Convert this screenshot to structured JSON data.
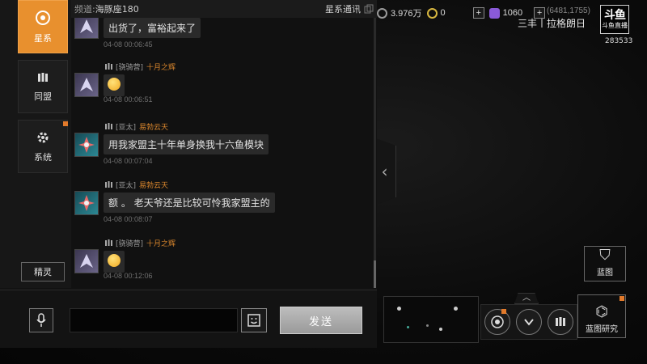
{
  "top_bar": {
    "resources": [
      {
        "icon": "credit-icon",
        "value": "3.976万",
        "color": "#9a9a9a"
      },
      {
        "icon": "alloy-icon",
        "value": "0",
        "color": "#d6b640"
      },
      {
        "icon": "crystal-icon",
        "value": "1060",
        "color": "#8a5ad8"
      }
    ],
    "plus_label": "+",
    "coordinates": "(6481,1755)",
    "player_name": "三丰丨拉格朗日",
    "logo_text": "斗鱼",
    "logo_sub": "斗鱼直播",
    "room_id": "283533"
  },
  "nav": {
    "tabs": [
      {
        "label": "星系",
        "icon": "galaxy-icon",
        "active": true
      },
      {
        "label": "同盟",
        "icon": "alliance-icon",
        "active": false
      },
      {
        "label": "系统",
        "icon": "system-gear-icon",
        "active": false
      }
    ],
    "sprite_label": "精灵"
  },
  "chat": {
    "channel_label": "频道:",
    "channel_name": "海豚座180",
    "star_comm_label": "星系通讯",
    "messages": [
      {
        "alliance": "",
        "name": "",
        "text": "出货了，富裕起来了",
        "time": "04-08 00:06:45"
      },
      {
        "alliance": "[骁骑营]",
        "name": "十月之辉",
        "text": "",
        "time": "04-08 00:06:51"
      },
      {
        "alliance": "[亚太]",
        "name": "易勃云天",
        "text": "用我家盟主十年单身换我十六鱼模块",
        "time": "04-08 00:07:04"
      },
      {
        "alliance": "[亚太]",
        "name": "易勃云天",
        "text": "额 。 老天爷还是比较可怜我家盟主的",
        "time": "04-08 00:08:07"
      },
      {
        "alliance": "[骁骑营]",
        "name": "十月之辉",
        "text": "",
        "time": "04-08 00:12:06"
      }
    ]
  },
  "input": {
    "placeholder": "",
    "send_label": "发送"
  },
  "right_ui": {
    "collapse_arrow": "‹",
    "blueprint_label": "蓝图",
    "blueprint_research_label": "蓝图研究",
    "up_arrow": "︿"
  }
}
